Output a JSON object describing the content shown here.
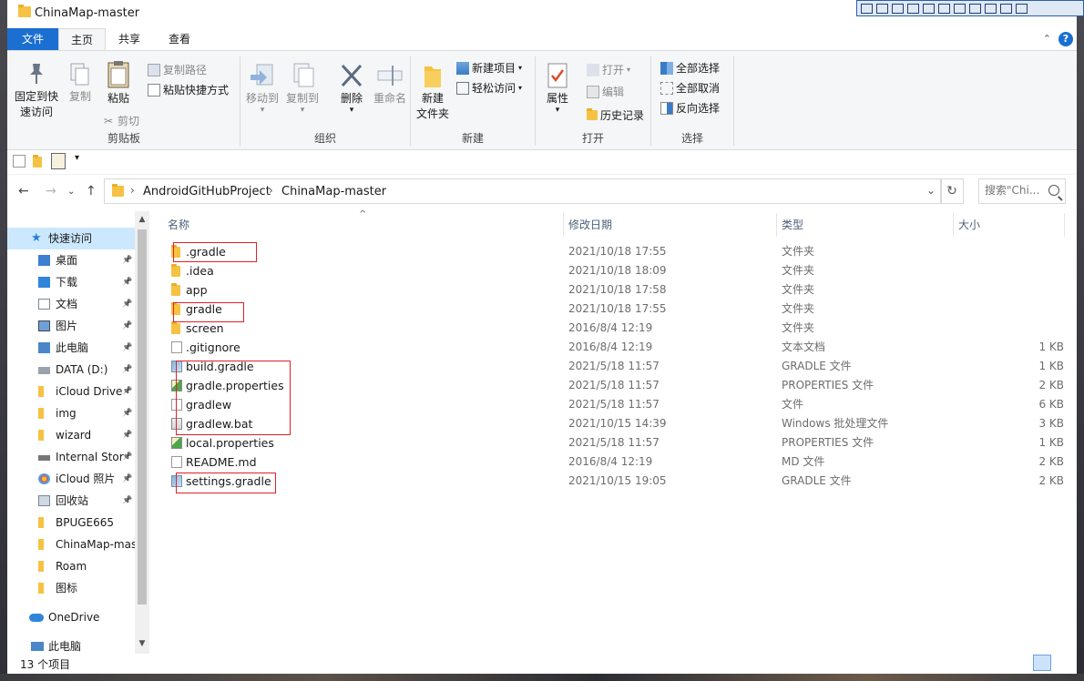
{
  "window": {
    "title": "ChinaMap-master"
  },
  "ribbon_tabs": {
    "file": "文件",
    "home": "主页",
    "share": "共享",
    "view": "查看",
    "help": "?"
  },
  "clipboard": {
    "pin_label": "固定到快\n速访问",
    "pin_l1": "固定到快",
    "pin_l2": "速访问",
    "copy": "复制",
    "paste": "粘贴",
    "copy_path": "复制路径",
    "paste_shortcut": "粘贴快捷方式",
    "cut": "剪切",
    "group": "剪贴板"
  },
  "organize": {
    "move_to": "移动到",
    "copy_to": "复制到",
    "delete": "删除",
    "rename": "重命名",
    "group": "组织"
  },
  "new_group": {
    "new_item": "新建项目",
    "easy_access": "轻松访问",
    "new_folder_l1": "新建",
    "new_folder_l2": "文件夹",
    "group": "新建"
  },
  "open_group": {
    "properties": "属性",
    "open": "打开",
    "edit": "编辑",
    "history": "历史记录",
    "group": "打开"
  },
  "select_group": {
    "select_all": "全部选择",
    "select_none": "全部取消",
    "invert": "反向选择",
    "group": "选择"
  },
  "address": {
    "crumbs": [
      "AndroidGitHubProject",
      "ChinaMap-master"
    ],
    "search_placeholder": "搜索\"Chi..."
  },
  "nav": {
    "quick_access": "快速访问",
    "items": [
      {
        "label": "桌面",
        "icon": "desktop-icon",
        "pinned": true
      },
      {
        "label": "下载",
        "icon": "download-icon",
        "pinned": true
      },
      {
        "label": "文档",
        "icon": "documents-icon",
        "pinned": true
      },
      {
        "label": "图片",
        "icon": "pictures-icon",
        "pinned": true
      },
      {
        "label": "此电脑",
        "icon": "this-pc-icon",
        "pinned": true
      },
      {
        "label": "DATA (D:)",
        "icon": "drive-icon",
        "pinned": true
      },
      {
        "label": "iCloud Drive",
        "icon": "folder-icon",
        "pinned": true
      },
      {
        "label": "img",
        "icon": "folder-icon",
        "pinned": true
      },
      {
        "label": "wizard",
        "icon": "folder-icon",
        "pinned": true
      },
      {
        "label": "Internal Stor",
        "icon": "device-icon",
        "pinned": true
      },
      {
        "label": "iCloud 照片",
        "icon": "icloud-photos-icon",
        "pinned": true
      },
      {
        "label": "回收站",
        "icon": "recycle-bin-icon",
        "pinned": true
      },
      {
        "label": "BPUGE665",
        "icon": "folder-icon",
        "pinned": false
      },
      {
        "label": "ChinaMap-mas",
        "icon": "folder-icon",
        "pinned": false
      },
      {
        "label": "Roam",
        "icon": "folder-icon",
        "pinned": false
      },
      {
        "label": "图标",
        "icon": "folder-icon",
        "pinned": false
      }
    ],
    "onedrive": "OneDrive",
    "this_pc": "此电脑"
  },
  "columns": {
    "name": "名称",
    "date": "修改日期",
    "type": "类型",
    "size": "大小"
  },
  "files": [
    {
      "name": ".gradle",
      "date": "2021/10/18 17:55",
      "type": "文件夹",
      "size": "",
      "kind": "folder"
    },
    {
      "name": ".idea",
      "date": "2021/10/18 18:09",
      "type": "文件夹",
      "size": "",
      "kind": "folder"
    },
    {
      "name": "app",
      "date": "2021/10/18 17:58",
      "type": "文件夹",
      "size": "",
      "kind": "folder"
    },
    {
      "name": "gradle",
      "date": "2021/10/18 17:55",
      "type": "文件夹",
      "size": "",
      "kind": "folder"
    },
    {
      "name": "screen",
      "date": "2016/8/4 12:19",
      "type": "文件夹",
      "size": "",
      "kind": "folder"
    },
    {
      "name": ".gitignore",
      "date": "2016/8/4 12:19",
      "type": "文本文档",
      "size": "1 KB",
      "kind": "doc"
    },
    {
      "name": "build.gradle",
      "date": "2021/5/18 11:57",
      "type": "GRADLE 文件",
      "size": "1 KB",
      "kind": "gradle"
    },
    {
      "name": "gradle.properties",
      "date": "2021/5/18 11:57",
      "type": "PROPERTIES 文件",
      "size": "2 KB",
      "kind": "prop"
    },
    {
      "name": "gradlew",
      "date": "2021/5/18 11:57",
      "type": "文件",
      "size": "6 KB",
      "kind": "doc"
    },
    {
      "name": "gradlew.bat",
      "date": "2021/10/15 14:39",
      "type": "Windows 批处理文件",
      "size": "3 KB",
      "kind": "bat"
    },
    {
      "name": "local.properties",
      "date": "2021/5/18 11:57",
      "type": "PROPERTIES 文件",
      "size": "1 KB",
      "kind": "prop"
    },
    {
      "name": "README.md",
      "date": "2016/8/4 12:19",
      "type": "MD 文件",
      "size": "2 KB",
      "kind": "doc"
    },
    {
      "name": "settings.gradle",
      "date": "2021/10/15 19:05",
      "type": "GRADLE 文件",
      "size": "2 KB",
      "kind": "gradle"
    }
  ],
  "status": {
    "item_count": "13 个项目"
  },
  "colors": {
    "accent": "#1a6fd0",
    "selection": "#cce8ff",
    "highlight_box": "#e0202a",
    "folder": "#f6c243"
  }
}
